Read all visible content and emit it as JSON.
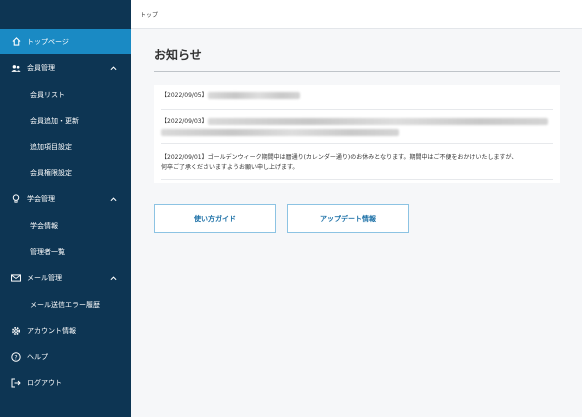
{
  "sidebar": {
    "items": [
      {
        "label": "トップページ",
        "icon": "home-icon"
      },
      {
        "label": "会員管理",
        "icon": "users-icon"
      },
      {
        "label": "会員リスト"
      },
      {
        "label": "会員追加・更新"
      },
      {
        "label": "追加項目設定"
      },
      {
        "label": "会員権限設定"
      },
      {
        "label": "学会管理",
        "icon": "lightbulb-icon"
      },
      {
        "label": "学会情報"
      },
      {
        "label": "管理者一覧"
      },
      {
        "label": "メール管理",
        "icon": "mail-icon"
      },
      {
        "label": "メール送信エラー履歴"
      },
      {
        "label": "アカウント情報",
        "icon": "gear-icon"
      },
      {
        "label": "ヘルプ",
        "icon": "help-icon"
      },
      {
        "label": "ログアウト",
        "icon": "logout-icon"
      }
    ]
  },
  "header": {
    "breadcrumb": "トップ"
  },
  "main": {
    "title": "お知らせ",
    "notices": [
      {
        "date": "【2022/09/05】"
      },
      {
        "date": "【2022/09/03】"
      },
      {
        "text_line1": "【2022/09/01】ゴールデンウィーク期間中は暦通り(カレンダー通り)のお休みとなります。期間中はご不便をおかけいたしますが、",
        "text_line2": "何卒ご了承くださいますようお願い申し上げます。"
      }
    ],
    "buttons": {
      "guide": "使い方ガイド",
      "update": "アップデート情報"
    }
  },
  "colors": {
    "sidebar_bg": "#0d3553",
    "sidebar_active": "#1a8ac4",
    "button_text": "#1a6fa6",
    "button_border": "#8cc3e3"
  }
}
